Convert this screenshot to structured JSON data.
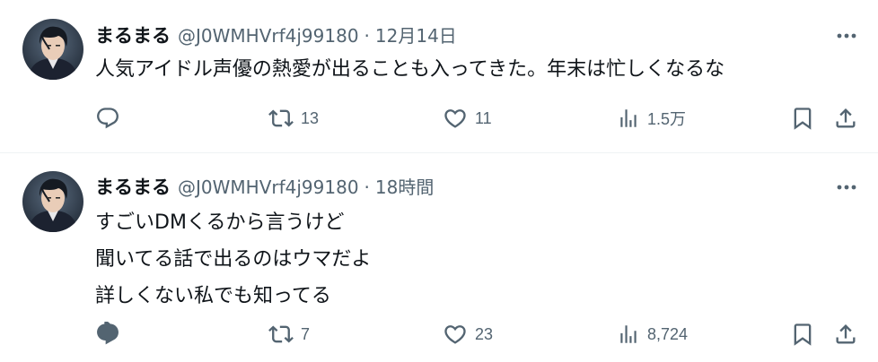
{
  "tweets": [
    {
      "display_name": "まるまる",
      "handle": "@J0WMHVrf4j99180",
      "separator": "·",
      "timestamp": "12月14日",
      "text_lines": [
        "人気アイドル声優の熱愛が出ることも入ってきた。年末は忙しくなるな"
      ],
      "replies": "",
      "retweets": "13",
      "likes": "11",
      "views": "1.5万"
    },
    {
      "display_name": "まるまる",
      "handle": "@J0WMHVrf4j99180",
      "separator": "·",
      "timestamp": "18時間",
      "text_lines": [
        "すごいDMくるから言うけど",
        "聞いてる話で出るのはウマだよ",
        "詳しくない私でも知ってる"
      ],
      "replies": "",
      "retweets": "7",
      "likes": "23",
      "views": "8,724"
    }
  ],
  "icons": {
    "more": "more-dots-icon",
    "reply": "reply-bubble-icon",
    "retweet": "retweet-arrows-icon",
    "like": "heart-icon",
    "views": "views-bar-chart-icon",
    "bookmark": "bookmark-icon",
    "share": "share-upload-icon"
  },
  "colors": {
    "text_primary": "#0f1419",
    "text_secondary": "#536471",
    "divider": "#eff3f4",
    "background": "#ffffff"
  }
}
